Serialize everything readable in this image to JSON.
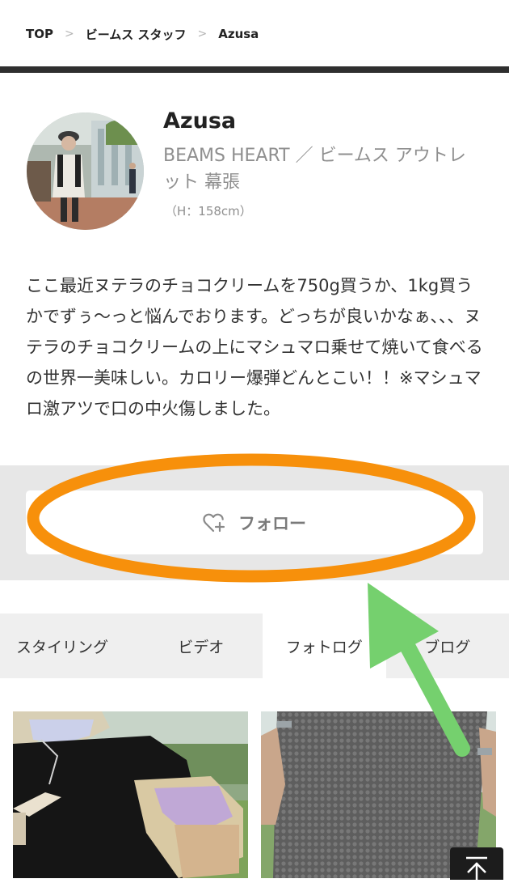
{
  "breadcrumb": {
    "items": [
      "TOP",
      "ビームス スタッフ",
      "Azusa"
    ],
    "separator": ">"
  },
  "profile": {
    "name": "Azusa",
    "shop": "BEAMS HEART ／ ビームス アウトレット 幕張",
    "height": "（H：158cm）"
  },
  "description": "ここ最近ヌテラのチョコクリームを750g買うか、1kg買うかでずぅ〜っと悩んでおります。どっちが良いかなぁ、、、ヌテラのチョコクリームの上にマシュマロ乗せて焼いて食べるの世界一美味しい。カロリー爆弾どんとこい！！※マシュマロ激アツで口の中火傷しました。",
  "follow": {
    "label": "フォロー",
    "icon": "heart-plus-icon"
  },
  "tabs": [
    {
      "label": "スタイリング",
      "active": false
    },
    {
      "label": "ビデオ",
      "active": false
    },
    {
      "label": "フォトログ",
      "active": true
    },
    {
      "label": "ブログ",
      "active": false
    }
  ],
  "back_to_top": {
    "icon": "arrow-up-to-top-icon"
  },
  "annotation": {
    "circle_color": "#f7900b",
    "arrow_color": "#75d06e"
  }
}
